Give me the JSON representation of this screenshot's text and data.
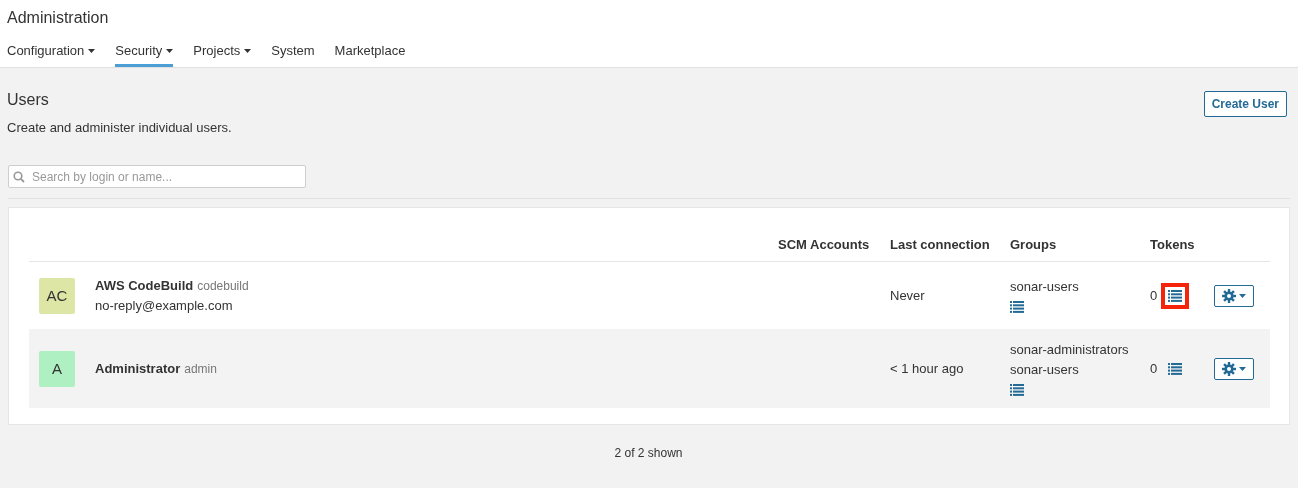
{
  "header": {
    "title": "Administration"
  },
  "nav": [
    {
      "label": "Configuration",
      "dropdown": true,
      "selected": false
    },
    {
      "label": "Security",
      "dropdown": true,
      "selected": true
    },
    {
      "label": "Projects",
      "dropdown": true,
      "selected": false
    },
    {
      "label": "System",
      "dropdown": false,
      "selected": false
    },
    {
      "label": "Marketplace",
      "dropdown": false,
      "selected": false
    }
  ],
  "page": {
    "title": "Users",
    "description": "Create and administer individual users.",
    "create_button": "Create User"
  },
  "search": {
    "placeholder": "Search by login or name..."
  },
  "table": {
    "columns": [
      "SCM Accounts",
      "Last connection",
      "Groups",
      "Tokens"
    ],
    "rows": [
      {
        "initials": "AC",
        "color": "#dee6a6",
        "name": "AWS CodeBuild",
        "login": "codebuild",
        "email": "no-reply@example.com",
        "last_connection": "Never",
        "groups": [
          "sonar-users"
        ],
        "tokens": "0",
        "tokens_highlighted": true
      },
      {
        "initials": "A",
        "color": "#aff0c3",
        "name": "Administrator",
        "login": "admin",
        "last_connection": "< 1 hour ago",
        "groups": [
          "sonar-administrators",
          "sonar-users"
        ],
        "tokens": "0",
        "tokens_highlighted": false
      }
    ]
  },
  "footer": "2 of 2 shown"
}
